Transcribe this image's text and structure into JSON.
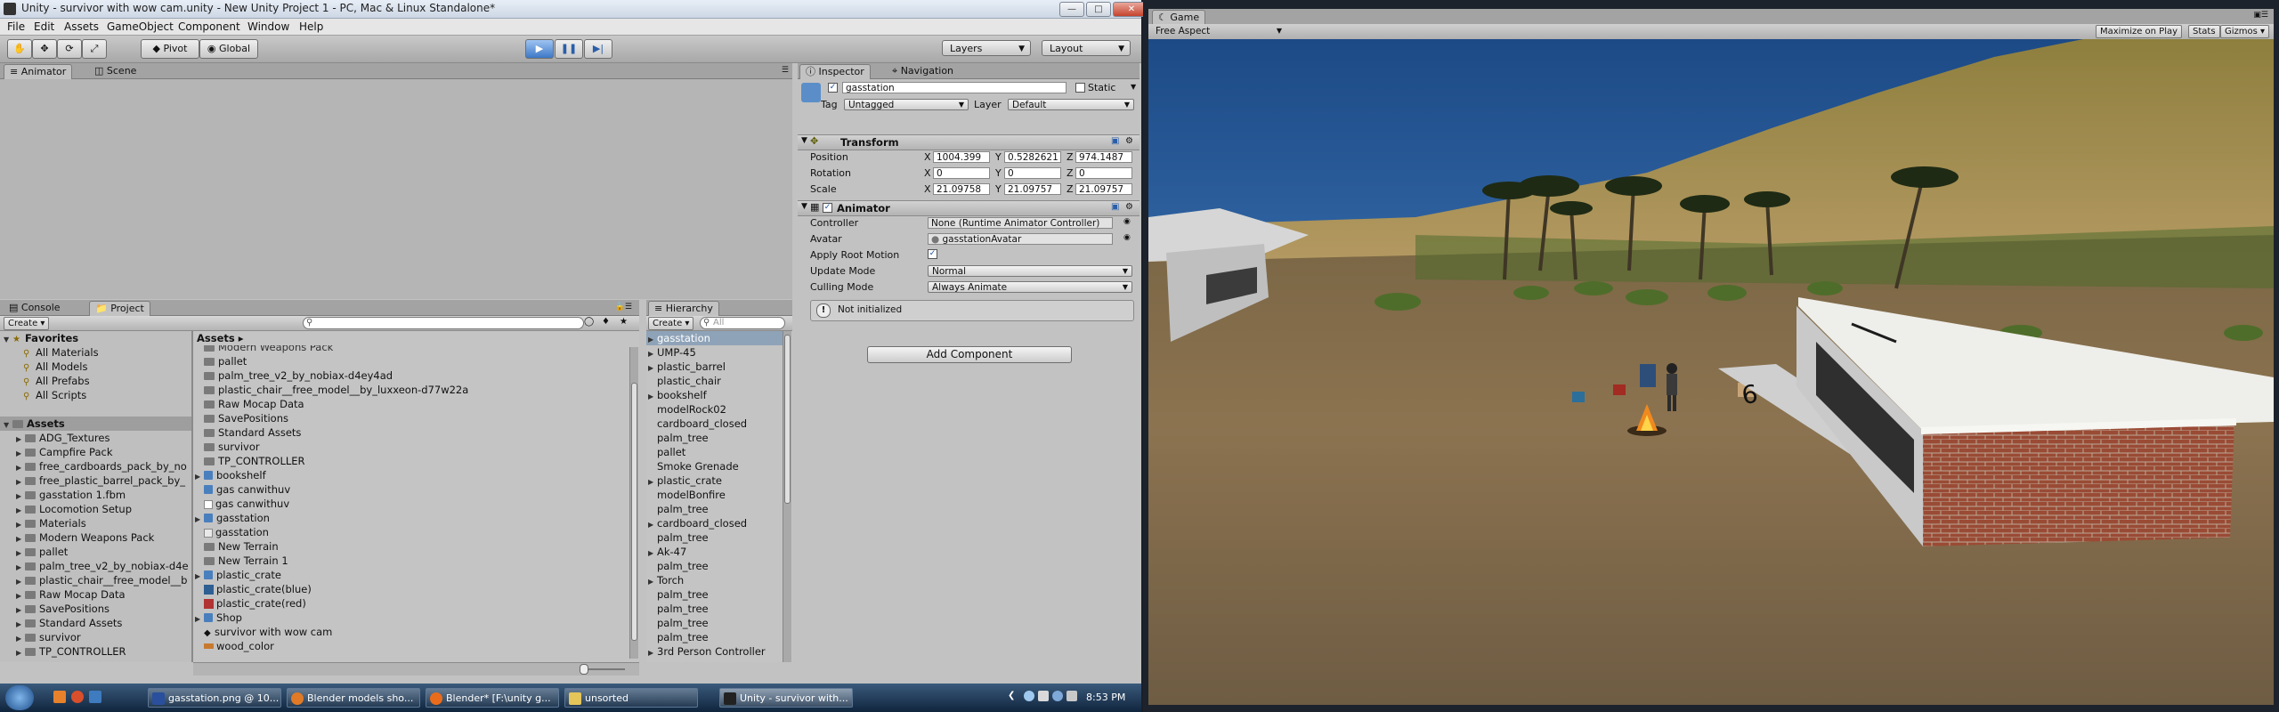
{
  "window": {
    "title": "Unity - survivor with wow cam.unity - New Unity Project 1 - PC, Mac & Linux Standalone*"
  },
  "menu": [
    "File",
    "Edit",
    "Assets",
    "GameObject",
    "Component",
    "Window",
    "Help"
  ],
  "toolbar": {
    "pivot": "Pivot",
    "global": "Global",
    "layers": "Layers",
    "layout": "Layout"
  },
  "top_tabs": {
    "animator": "Animator",
    "scene": "Scene"
  },
  "bottom_tabs": {
    "console": "Console",
    "project": "Project",
    "hierarchy": "Hierarchy"
  },
  "project": {
    "create": "Create",
    "favorites_label": "Favorites",
    "favorites": [
      "All Materials",
      "All Models",
      "All Prefabs",
      "All Scripts"
    ],
    "assets_label": "Assets",
    "tree": [
      "ADG_Textures",
      "Campfire Pack",
      "free_cardboards_pack_by_no",
      "free_plastic_barrel_pack_by_",
      "gasstation 1.fbm",
      "Locomotion Setup",
      "Materials",
      "Modern Weapons Pack",
      "pallet",
      "palm_tree_v2_by_nobiax-d4e",
      "plastic_chair__free_model__b",
      "Raw Mocap Data",
      "SavePositions",
      "Standard Assets",
      "survivor",
      "TP_CONTROLLER"
    ],
    "breadcrumb": "Assets ▸",
    "list_cut": "Modern Weapons Pack",
    "list": [
      {
        "name": "pallet",
        "icon": "folder"
      },
      {
        "name": "palm_tree_v2_by_nobiax-d4ey4ad",
        "icon": "folder"
      },
      {
        "name": "plastic_chair__free_model__by_luxxeon-d77w22a",
        "icon": "folder"
      },
      {
        "name": "Raw Mocap Data",
        "icon": "folder"
      },
      {
        "name": "SavePositions",
        "icon": "folder"
      },
      {
        "name": "Standard Assets",
        "icon": "folder"
      },
      {
        "name": "survivor",
        "icon": "folder"
      },
      {
        "name": "TP_CONTROLLER",
        "icon": "folder"
      },
      {
        "name": "bookshelf",
        "icon": "prefab"
      },
      {
        "name": "gas canwithuv",
        "icon": "prefab"
      },
      {
        "name": "gas canwithuv",
        "icon": "blank"
      },
      {
        "name": "gasstation",
        "icon": "prefab"
      },
      {
        "name": "gasstation",
        "icon": "animator"
      },
      {
        "name": "New Terrain",
        "icon": "folder"
      },
      {
        "name": "New Terrain 1",
        "icon": "folder"
      },
      {
        "name": "plastic_crate",
        "icon": "prefab"
      },
      {
        "name": "plastic_crate(blue)",
        "icon": "blue"
      },
      {
        "name": "plastic_crate(red)",
        "icon": "red"
      },
      {
        "name": "Shop",
        "icon": "prefab"
      },
      {
        "name": "survivor with wow cam",
        "icon": "unity"
      },
      {
        "name": "wood_color",
        "icon": "orange"
      }
    ]
  },
  "hierarchy": {
    "create": "Create",
    "search_placeholder": "All",
    "items": [
      "gasstation",
      "UMP-45",
      "plastic_barrel",
      "plastic_chair",
      "bookshelf",
      "modelRock02",
      "cardboard_closed",
      "palm_tree",
      "pallet",
      "Smoke Grenade",
      "plastic_crate",
      "modelBonfire",
      "palm_tree",
      "cardboard_closed",
      "palm_tree",
      "Ak-47",
      "palm_tree",
      "Torch",
      "palm_tree",
      "palm_tree",
      "palm_tree",
      "palm_tree",
      "3rd Person Controller"
    ]
  },
  "inspector": {
    "tab": "Inspector",
    "nav_tab": "Navigation",
    "object_name": "gasstation",
    "static": "Static",
    "tag_label": "Tag",
    "tag": "Untagged",
    "layer_label": "Layer",
    "layer": "Default",
    "transform": {
      "title": "Transform",
      "position_label": "Position",
      "rotation_label": "Rotation",
      "scale_label": "Scale",
      "position": [
        "1004.399",
        "0.5282621",
        "974.1487"
      ],
      "rotation": [
        "0",
        "0",
        "0"
      ],
      "scale": [
        "21.09758",
        "21.09757",
        "21.09757"
      ]
    },
    "animator": {
      "title": "Animator",
      "controller_label": "Controller",
      "controller": "None (Runtime Animator Controller)",
      "avatar_label": "Avatar",
      "avatar": "gasstationAvatar",
      "apply_root_motion_label": "Apply Root Motion",
      "update_mode_label": "Update Mode",
      "update_mode": "Normal",
      "culling_mode_label": "Culling Mode",
      "culling_mode": "Always Animate",
      "status": "Not initialized"
    },
    "add_component": "Add Component"
  },
  "taskbar": {
    "items": [
      "gasstation.png @ 10...",
      "Blender models sho...",
      "Blender* [F:\\unity g...",
      "unsorted",
      "Unity - survivor with..."
    ],
    "time": "8:53 PM"
  },
  "game": {
    "tab": "Game",
    "aspect": "Free Aspect",
    "maximize": "Maximize on Play",
    "stats": "Stats",
    "gizmos": "Gizmos",
    "sign_number": "6"
  },
  "colors": {
    "play_blue": "#3d78c6",
    "panel": "#c2c2c2",
    "sky": "#1f4c86",
    "sand": "#b89463",
    "brick": "#9a4b35"
  }
}
